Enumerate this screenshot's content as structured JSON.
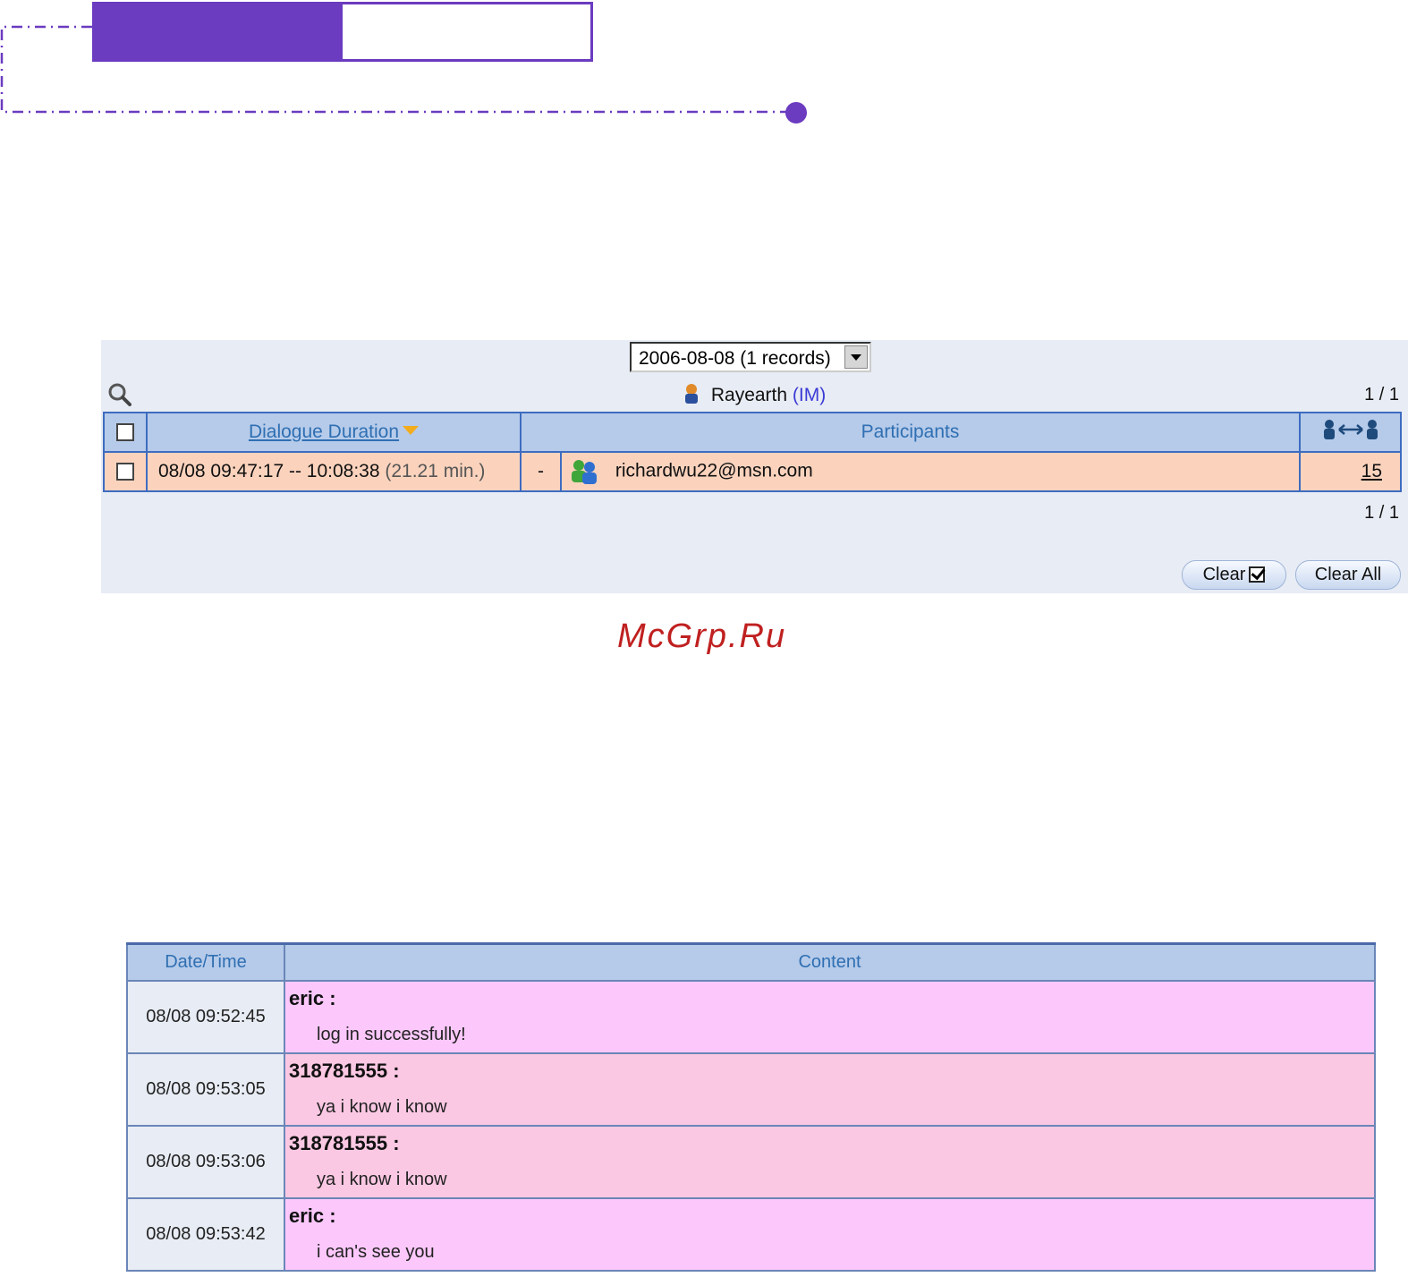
{
  "panel": {
    "date_select": "2006-08-08 (1 records)",
    "user_name": "Rayearth",
    "user_protocol": "(IM)",
    "page_top": "1 / 1",
    "page_bottom": "1 / 1",
    "table": {
      "headers": {
        "duration": "Dialogue Duration",
        "participants": "Participants"
      },
      "row": {
        "duration": "08/08 09:47:17 -- 10:08:38",
        "duration_minutes": "(21.21 min.)",
        "direction": "-",
        "participant": "richardwu22@msn.com",
        "message_count": "15"
      }
    },
    "buttons": {
      "clear_checked": "Clear",
      "clear_all": "Clear All"
    }
  },
  "watermark": "McGrp.Ru",
  "chat": {
    "headers": {
      "time": "Date/Time",
      "content": "Content"
    },
    "rows": [
      {
        "time": "08/08 09:52:45",
        "sender": "eric :",
        "message": "log in successfully!"
      },
      {
        "time": "08/08 09:53:05",
        "sender": "318781555 :",
        "message": "ya i know i know"
      },
      {
        "time": "08/08 09:53:06",
        "sender": "318781555 :",
        "message": "ya i know i know"
      },
      {
        "time": "08/08 09:53:42",
        "sender": "eric :",
        "message": "i can's see you"
      }
    ]
  },
  "colors": {
    "accent_purple": "#6b3bc0",
    "header_blue": "#b6cbea",
    "row_peach": "#fbd3bd",
    "chat_pink": "#fcc8fb"
  }
}
